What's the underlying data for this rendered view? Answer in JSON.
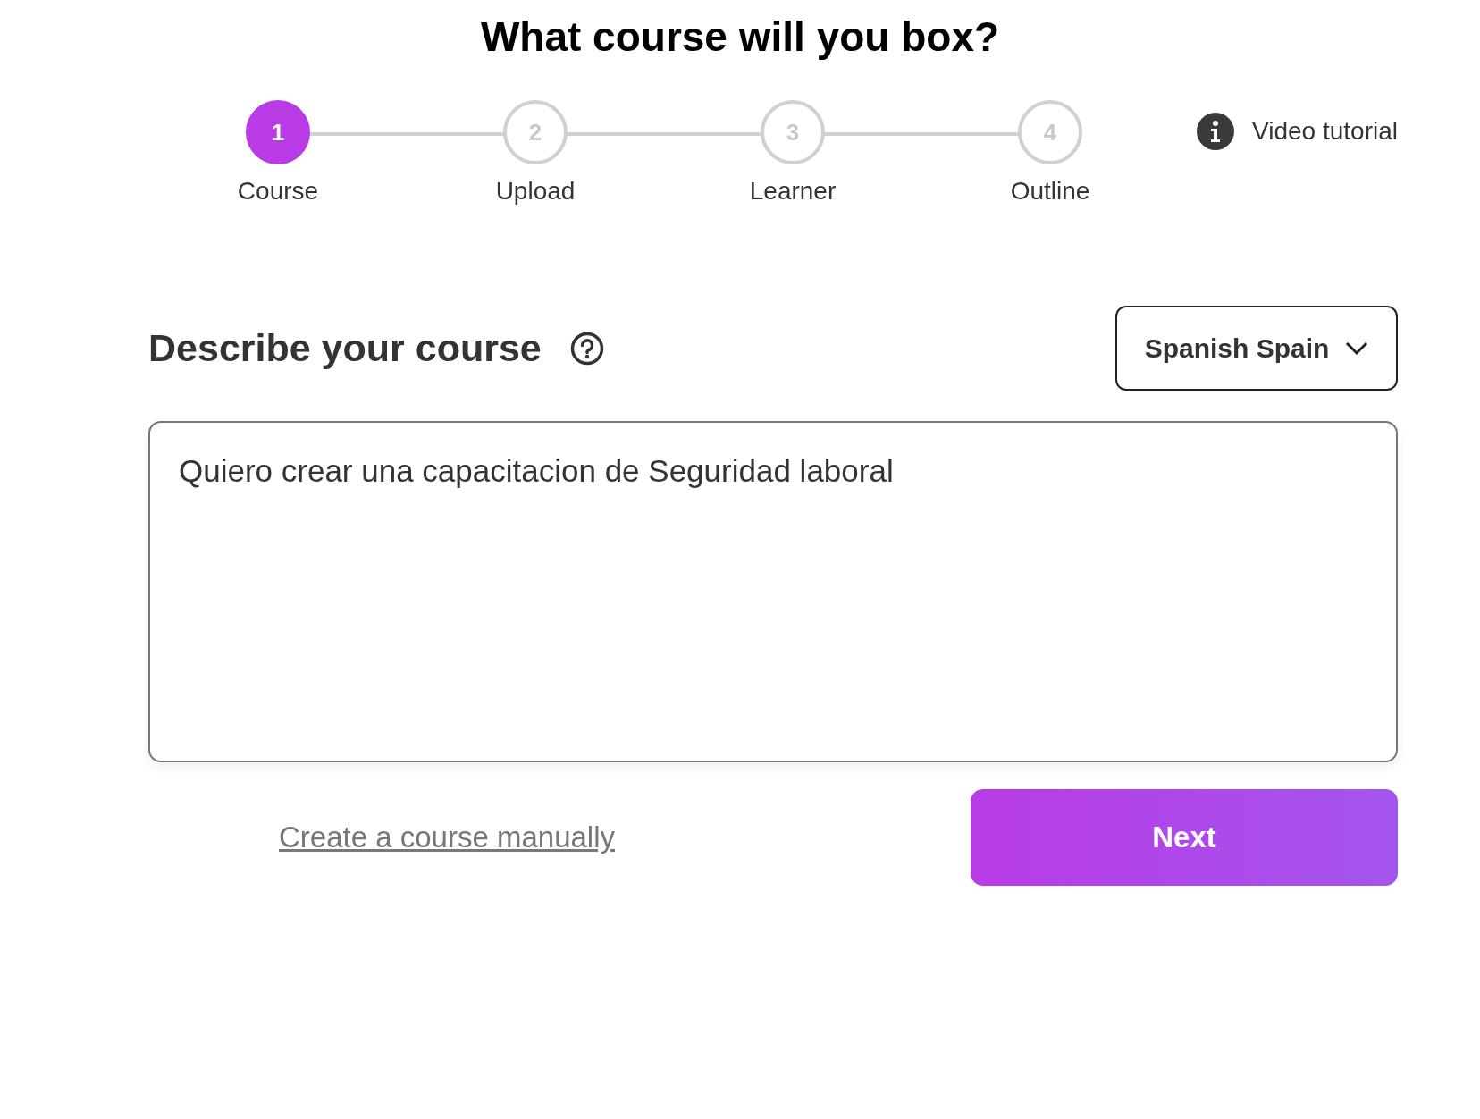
{
  "title": "What course will you box?",
  "steps": [
    {
      "number": "1",
      "label": "Course",
      "selected": true
    },
    {
      "number": "2",
      "label": "Upload",
      "selected": false
    },
    {
      "number": "3",
      "label": "Learner",
      "selected": false
    },
    {
      "number": "4",
      "label": "Outline",
      "selected": false
    }
  ],
  "video_tutorial": {
    "label": "Video tutorial"
  },
  "section": {
    "heading": "Describe your course"
  },
  "language_select": {
    "value": "Spanish Spain"
  },
  "description": {
    "value": "Quiero crear una capacitacion de Seguridad laboral"
  },
  "manual_link": "Create a course manually",
  "next_button": "Next"
}
